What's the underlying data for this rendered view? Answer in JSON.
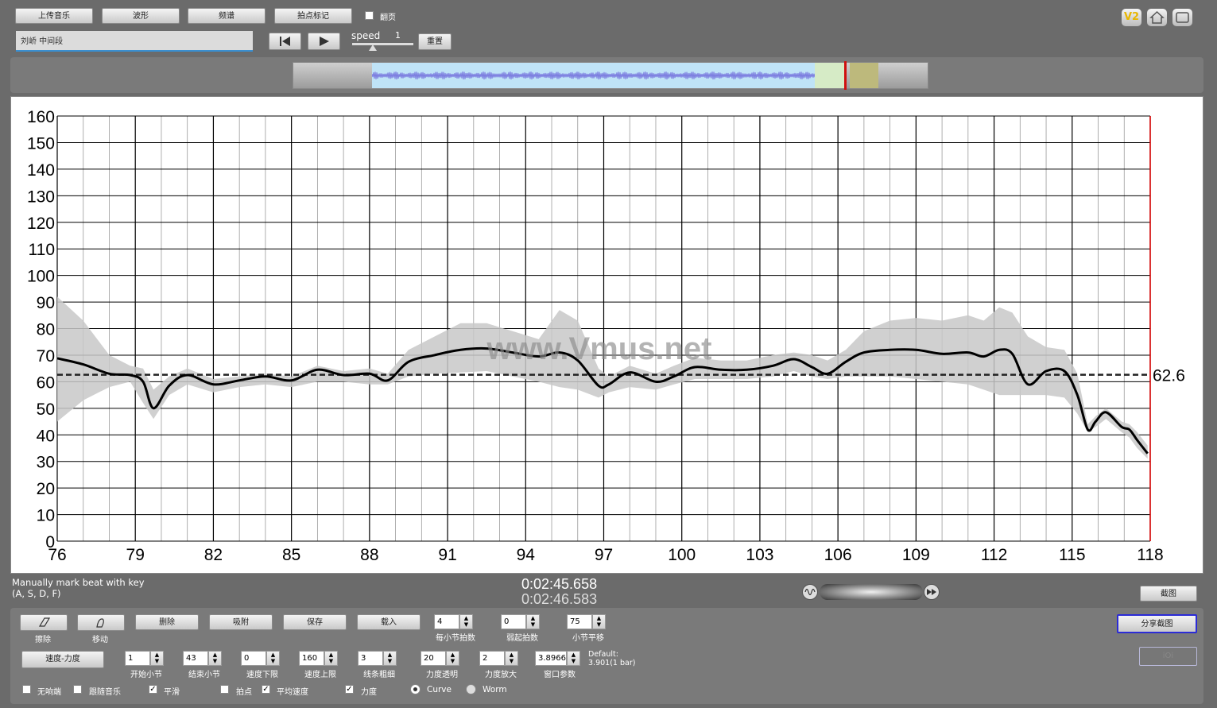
{
  "toolbar": {
    "upload_label": "上传音乐",
    "waveform_label": "波形",
    "spectrum_label": "频谱",
    "beat_mark_label": "拍点标记",
    "page_turn_label": "翻页",
    "track_name": "刘峤 中间段",
    "speed_label": "speed",
    "speed_value": "1",
    "reset_label": "重置",
    "v2_label": "V2"
  },
  "status": {
    "hint_line1": "Manually mark beat with key",
    "hint_line2": "(A, S, D, F)",
    "time_current": "0:02:45.658",
    "time_end": "0:02:46.583",
    "screenshot_label": "截图"
  },
  "controls": {
    "erase_label": "擦除",
    "move_label": "移动",
    "delete_label": "删除",
    "absorb_label": "吸附",
    "save_label": "保存",
    "load_label": "载入",
    "beats_per_bar": {
      "value": "4",
      "label": "每小节拍数"
    },
    "upbeat": {
      "value": "0",
      "label": "弱起拍数"
    },
    "bar_shift": {
      "value": "75",
      "label": "小节平移"
    },
    "tempo_dynamics_label": "速度-力度",
    "start_bar": {
      "value": "1",
      "label": "开始小节"
    },
    "end_bar": {
      "value": "43",
      "label": "结束小节"
    },
    "tempo_min": {
      "value": "0",
      "label": "速度下限"
    },
    "tempo_max": {
      "value": "160",
      "label": "速度上限"
    },
    "line_width": {
      "value": "3",
      "label": "线条粗细"
    },
    "dyn_transparency": {
      "value": "20",
      "label": "力度透明"
    },
    "dyn_scale": {
      "value": "2",
      "label": "力度放大"
    },
    "window_param": {
      "value": "3.8966",
      "label": "窗口参数"
    },
    "default_line1": "Default:",
    "default_line2": "3.901(1 bar)",
    "share_screenshot_label": "分享截图",
    "disabled_button_label": "iOi",
    "checkboxes": [
      {
        "label": "无响端",
        "checked": false
      },
      {
        "label": "跟随音乐",
        "checked": false
      },
      {
        "label": "平滑",
        "checked": true
      },
      {
        "label": "拍点",
        "checked": false
      },
      {
        "label": "平均速度",
        "checked": true
      },
      {
        "label": "力度",
        "checked": true
      }
    ],
    "radios": [
      {
        "label": "Curve",
        "selected": true
      },
      {
        "label": "Worm",
        "selected": false
      }
    ]
  },
  "watermark": "www.Vmus.net",
  "chart_data": {
    "type": "line",
    "title": "",
    "xlabel": "",
    "ylabel": "",
    "xlim": [
      76,
      118
    ],
    "ylim": [
      0,
      160
    ],
    "x_ticks": [
      76,
      79,
      82,
      85,
      88,
      91,
      94,
      97,
      100,
      103,
      106,
      109,
      112,
      115,
      118
    ],
    "y_ticks": [
      0,
      10,
      20,
      30,
      40,
      50,
      60,
      70,
      80,
      90,
      100,
      110,
      120,
      130,
      140,
      150,
      160
    ],
    "grid": true,
    "cursor_x": 118,
    "average_tempo": 62.6,
    "average_label": "62.6",
    "series": [
      {
        "x": [
          76,
          77,
          78,
          78.8,
          79.3,
          79.7,
          80.3,
          81,
          82,
          83,
          84,
          85,
          86,
          87,
          88,
          88.7,
          89.5,
          90.5,
          91.5,
          92.5,
          93.5,
          94.5,
          95.3,
          96,
          96.8,
          97.2,
          98,
          99,
          99.7,
          100.5,
          101.5,
          102.5,
          103.5,
          104.3,
          105,
          105.6,
          106.3,
          107,
          108,
          109,
          110,
          111,
          111.6,
          112.2,
          112.7,
          113.3,
          114,
          114.7,
          115.2,
          115.6,
          115.9,
          116.3,
          116.9,
          117.2,
          117.5,
          117.9
        ],
        "values": [
          68.8,
          66.5,
          63,
          62.5,
          60,
          50,
          58.5,
          62.5,
          59,
          60.5,
          62,
          60.5,
          64.5,
          62.5,
          63,
          60.5,
          67.5,
          70,
          72,
          72.5,
          71,
          69.5,
          71,
          68,
          58.5,
          59,
          63.5,
          60,
          62,
          65.5,
          64.5,
          64.5,
          66,
          68.5,
          65.5,
          63,
          67.5,
          71,
          72,
          72,
          70.5,
          71,
          69.5,
          72,
          70.5,
          59,
          64,
          64,
          55,
          42,
          45,
          48.5,
          43,
          42,
          38,
          33
        ]
      },
      {
        "lower": [
          45,
          53,
          58,
          60,
          52,
          46,
          55,
          59,
          56,
          58,
          59,
          58,
          60,
          60,
          59,
          59,
          62,
          63,
          63.5,
          64,
          62,
          60,
          58,
          57,
          54,
          56,
          58,
          57,
          59,
          61,
          61,
          61,
          62,
          64,
          62,
          61,
          62,
          62,
          62,
          61,
          60,
          59,
          57,
          55,
          55,
          55,
          55,
          54,
          48,
          41,
          43,
          46,
          41,
          39,
          35,
          31
        ],
        "upper": [
          92,
          83,
          70,
          66,
          65,
          57,
          62,
          65,
          61,
          62,
          63,
          62,
          66,
          64,
          65,
          63,
          72,
          77,
          82,
          82,
          79,
          76,
          87,
          83,
          65,
          62,
          66,
          63,
          66,
          69,
          68,
          68,
          70,
          71,
          70,
          68,
          72,
          79,
          83,
          84,
          83,
          85,
          83,
          88,
          86,
          77,
          73,
          72,
          63,
          44,
          47,
          50,
          45,
          44,
          41,
          36
        ]
      }
    ]
  }
}
